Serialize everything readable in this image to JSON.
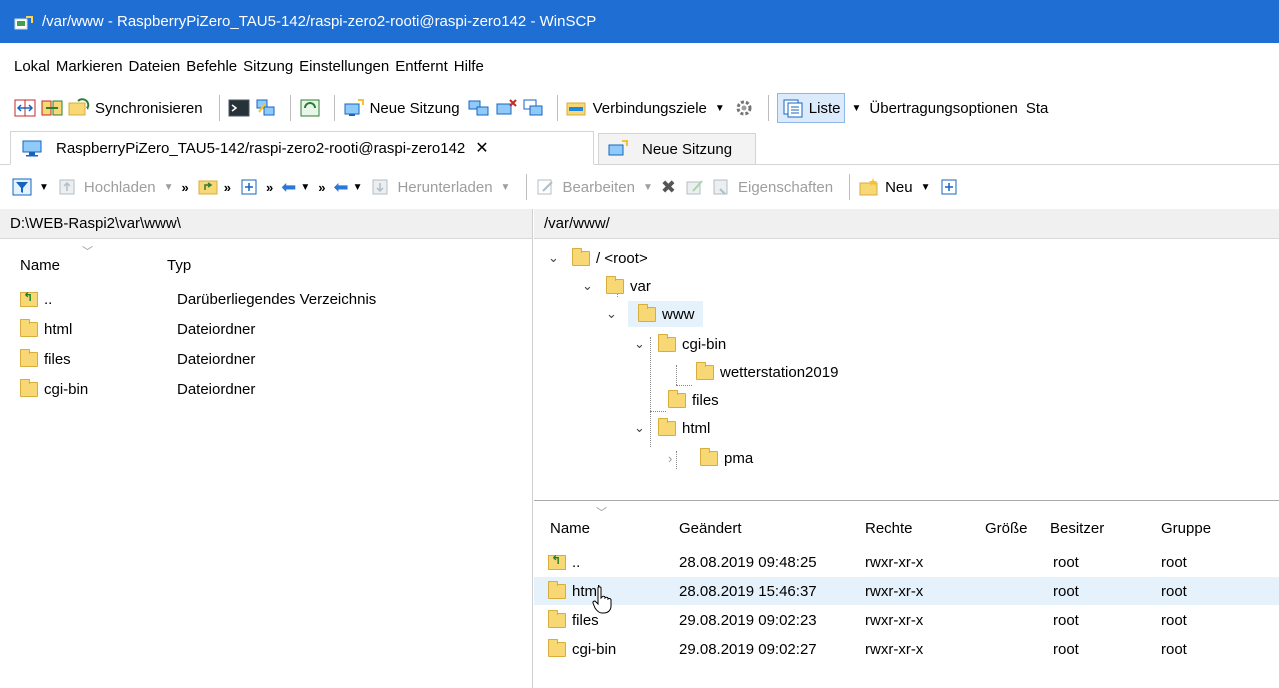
{
  "window": {
    "title": "/var/www - RaspberryPiZero_TAU5-142/raspi-zero2-rooti@raspi-zero142 - WinSCP"
  },
  "menu": [
    "Lokal",
    "Markieren",
    "Dateien",
    "Befehle",
    "Sitzung",
    "Einstellungen",
    "Entfernt",
    "Hilfe"
  ],
  "toolbar": {
    "synchronize_label": "Synchronisieren",
    "new_session_label": "Neue Sitzung",
    "bookmarks_label": "Verbindungsziele",
    "view_label": "Liste",
    "transfer_label": "Übertragungsoptionen",
    "transfer_more": "Sta"
  },
  "tabs": {
    "session_label": "RaspberryPiZero_TAU5-142/raspi-zero2-rooti@raspi-zero142",
    "close_glyph": "✕",
    "new_tab_label": "Neue Sitzung"
  },
  "panel_toolbar": {
    "upload_label": "Hochladen",
    "download_label": "Herunterladen",
    "edit_label": "Bearbeiten",
    "properties_label": "Eigenschaften",
    "new_label": "Neu",
    "chevron": "»"
  },
  "local_panel": {
    "path": "D:\\WEB-Raspi2\\var\\www\\",
    "columns": {
      "name": "Name",
      "type": "Typ"
    },
    "rows": [
      {
        "name": "..",
        "type": "Darüberliegendes Verzeichnis",
        "kind": "up"
      },
      {
        "name": "html",
        "type": "Dateiordner",
        "kind": "folder"
      },
      {
        "name": "files",
        "type": "Dateiordner",
        "kind": "folder"
      },
      {
        "name": "cgi-bin",
        "type": "Dateiordner",
        "kind": "folder"
      }
    ]
  },
  "remote_panel": {
    "path": "/var/www/",
    "tree": {
      "root": "/ <root>",
      "var": "var",
      "www": "www",
      "cgi_bin": "cgi-bin",
      "wetterstation": "wetterstation2019",
      "files": "files",
      "html": "html",
      "pma": "pma"
    },
    "columns": {
      "name": "Name",
      "changed": "Geändert",
      "rights": "Rechte",
      "size": "Größe",
      "owner": "Besitzer",
      "group": "Gruppe"
    },
    "rows": [
      {
        "name": "..",
        "changed": "28.08.2019 09:48:25",
        "rights": "rwxr-xr-x",
        "owner": "root",
        "group": "root",
        "kind": "up"
      },
      {
        "name": "html",
        "changed": "28.08.2019 15:46:37",
        "rights": "rwxr-xr-x",
        "owner": "root",
        "group": "root",
        "kind": "folder"
      },
      {
        "name": "files",
        "changed": "29.08.2019 09:02:23",
        "rights": "rwxr-xr-x",
        "owner": "root",
        "group": "root",
        "kind": "folder"
      },
      {
        "name": "cgi-bin",
        "changed": "29.08.2019 09:02:27",
        "rights": "rwxr-xr-x",
        "owner": "root",
        "group": "root",
        "kind": "folder"
      }
    ]
  },
  "colors": {
    "titlebar": "#1e6ed4",
    "selection": "#e5f1fb",
    "folder": "#f8d775"
  }
}
